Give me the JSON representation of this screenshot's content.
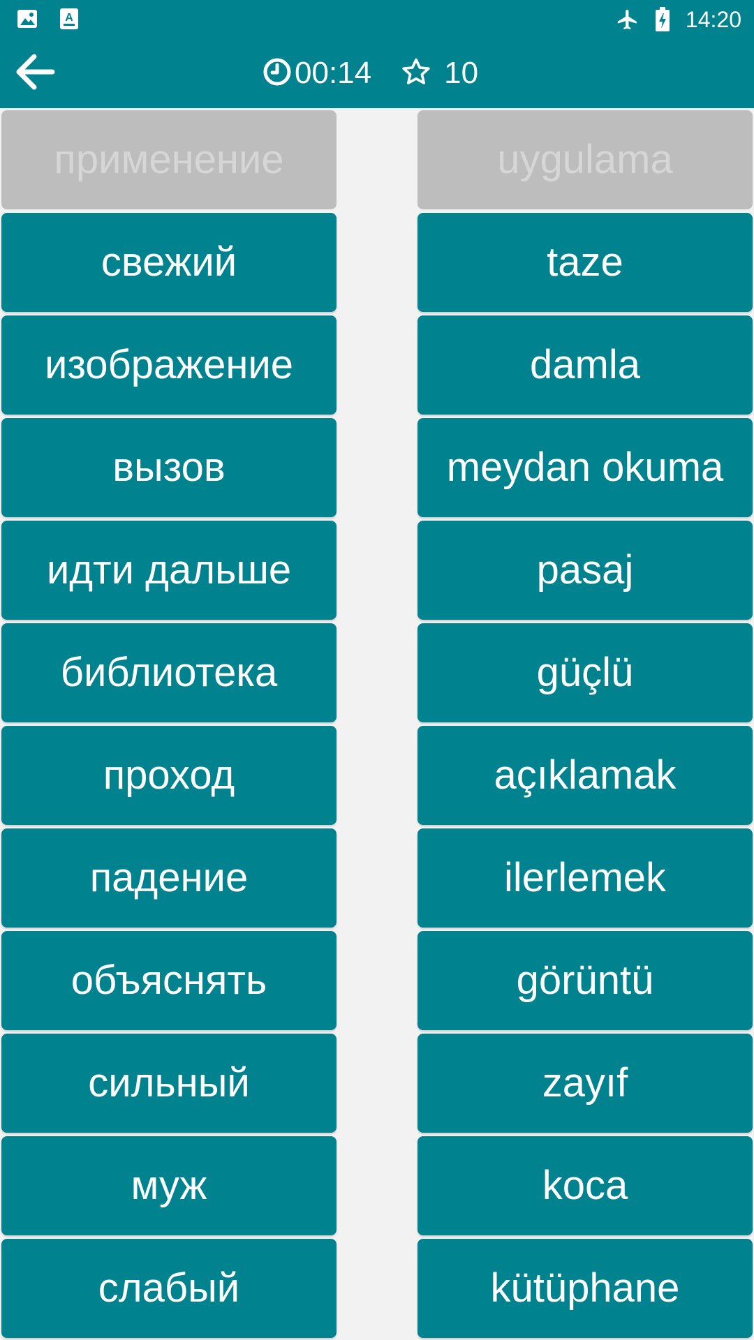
{
  "status_bar": {
    "time": "14:20",
    "icons": [
      "image-icon",
      "text-format-icon",
      "airplane-icon",
      "battery-charging-icon"
    ]
  },
  "toolbar": {
    "back_icon": "arrow-left-icon",
    "timer_icon": "clock-icon",
    "timer": "00:14",
    "score_icon": "star-outline-icon",
    "score": "10"
  },
  "colors": {
    "primary": "#00838f",
    "matched_card": "#bdbdbd",
    "matched_text": "#d6d6d6",
    "background": "#f2f2f2",
    "text": "#ffffff"
  },
  "left_words": [
    {
      "text": "применение",
      "state": "matched"
    },
    {
      "text": "свежий",
      "state": "active"
    },
    {
      "text": "изображение",
      "state": "active"
    },
    {
      "text": "вызов",
      "state": "active"
    },
    {
      "text": "идти дальше",
      "state": "active"
    },
    {
      "text": "библиотека",
      "state": "active"
    },
    {
      "text": "проход",
      "state": "active"
    },
    {
      "text": "падение",
      "state": "active"
    },
    {
      "text": "объяснять",
      "state": "active"
    },
    {
      "text": "сильный",
      "state": "active"
    },
    {
      "text": "муж",
      "state": "active"
    },
    {
      "text": "слабый",
      "state": "active"
    }
  ],
  "right_words": [
    {
      "text": "uygulama",
      "state": "matched"
    },
    {
      "text": "taze",
      "state": "active"
    },
    {
      "text": "damla",
      "state": "active"
    },
    {
      "text": "meydan okuma",
      "state": "active"
    },
    {
      "text": "pasaj",
      "state": "active"
    },
    {
      "text": "güçlü",
      "state": "active"
    },
    {
      "text": "açıklamak",
      "state": "active"
    },
    {
      "text": "ilerlemek",
      "state": "active"
    },
    {
      "text": "görüntü",
      "state": "active"
    },
    {
      "text": "zayıf",
      "state": "active"
    },
    {
      "text": "koca",
      "state": "active"
    },
    {
      "text": "kütüphane",
      "state": "active"
    }
  ]
}
